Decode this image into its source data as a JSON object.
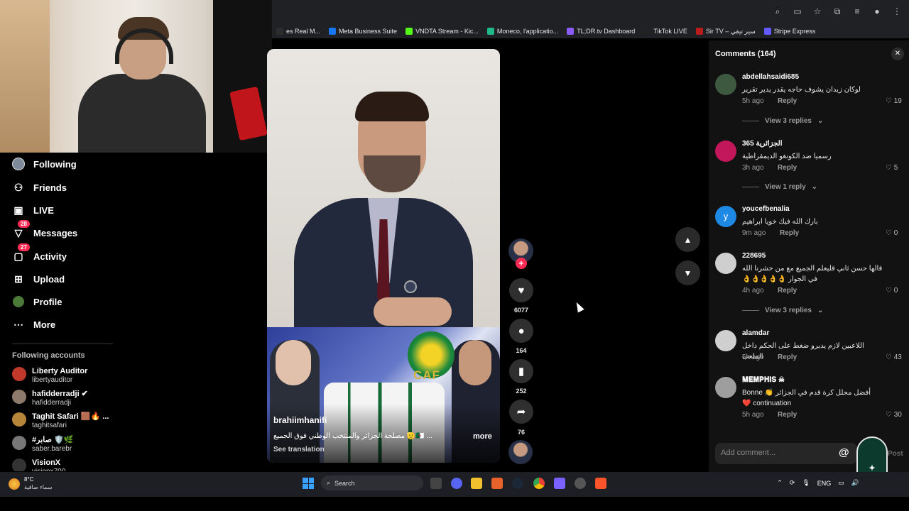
{
  "browser": {
    "bookmarks": [
      {
        "label": "es Real M...",
        "color": "#2d2d2d"
      },
      {
        "label": "Meta Business Suite",
        "color": "#1877f2"
      },
      {
        "label": "VNDTA Stream - Kic...",
        "color": "#53fc18"
      },
      {
        "label": "Moneco, l'applicatio...",
        "color": "#1fb98a"
      },
      {
        "label": "TL;DR.tv Dashboard",
        "color": "#8b5cf6"
      },
      {
        "label": "TikTok LIVE",
        "color": "#222222"
      },
      {
        "label": "Sir TV – سير تيفي",
        "color": "#b91c1c"
      },
      {
        "label": "Stripe Express",
        "color": "#635bff"
      }
    ]
  },
  "nav": {
    "items": [
      {
        "label": "Following",
        "icon": "avatar-icon"
      },
      {
        "label": "Friends",
        "icon": "friends-icon"
      },
      {
        "label": "LIVE",
        "icon": "live-icon"
      },
      {
        "label": "Messages",
        "icon": "messages-icon",
        "badge": "28"
      },
      {
        "label": "Activity",
        "icon": "activity-icon",
        "badge": "27"
      },
      {
        "label": "Upload",
        "icon": "upload-icon"
      },
      {
        "label": "Profile",
        "icon": "profile-icon"
      },
      {
        "label": "More",
        "icon": "more-icon"
      }
    ],
    "following_header": "Following accounts",
    "following": [
      {
        "name": "Liberty Auditor",
        "user": "libertyauditor",
        "color": "#c0392b"
      },
      {
        "name": "hafidderradji ✔",
        "user": "hafidderradji",
        "color": "#8e7a6a"
      },
      {
        "name": "Taghit Safari 🟫🔥 ...",
        "user": "taghitsafari",
        "color": "#b5863a"
      },
      {
        "name": "#صابر 🛡️🌿",
        "user": "saber.barebr",
        "color": "#777777"
      },
      {
        "name": "VisionX",
        "user": "visionx700",
        "color": "#333333"
      }
    ]
  },
  "video": {
    "author": "brahiimhanifi",
    "caption": "مصلحة الجزائر والمنتخب الوطني فوق الجميع 🫡🇩🇿 ...",
    "more_label": "more",
    "translate_label": "See translation",
    "caf_text": "CAF"
  },
  "actions": {
    "likes": "6077",
    "comments": "164",
    "saves": "252",
    "shares": "76"
  },
  "comments": {
    "title": "Comments (164)",
    "reply_label": "Reply",
    "add_placeholder": "Add comment...",
    "at_label": "@",
    "post_label": "Post",
    "items": [
      {
        "user": "abdellahsaidi685",
        "text": "لوكان زيدان يشوف حاجه يقدر يدير تقرير",
        "time": "5h ago",
        "likes": "19",
        "view": "View 3 replies",
        "color": "#3d5a40"
      },
      {
        "user": "الجزائرية 365",
        "text": "رسميا ضد الكونغو الديمقراطية",
        "time": "3h ago",
        "likes": "5",
        "view": "View 1 reply",
        "color": "#c2185b"
      },
      {
        "user": "youcefbenalia",
        "text": "بارك الله فيك خويا ابراهيم",
        "time": "9m ago",
        "likes": "0",
        "view": "",
        "color": "#1e88e5",
        "initial": "y"
      },
      {
        "user": "228695",
        "text": "قالها حسن ثاني قليعلم الجميع مع من حشرنا الله في الجوار 👌👌👌👌👌",
        "time": "4h ago",
        "likes": "0",
        "view": "View 3 replies",
        "color": "#cfcfcf"
      },
      {
        "user": "alamdar",
        "text": "اللاعبين لازم يديرو ضغط على الحكم داخل الملعب",
        "time": "5h ago",
        "likes": "43",
        "view": "",
        "color": "#cfcfcf"
      },
      {
        "user": "𝐌𝐄𝐌𝐏𝐇𝐈𝐒 ☠",
        "text": "أفضل محلل كرة قدم في الجزائر 👏 Bonne continuation ❤️",
        "time": "5h ago",
        "likes": "30",
        "view": "",
        "color": "#9e9e9e"
      }
    ]
  },
  "taskbar": {
    "temp": "8°C",
    "weather": "سماء صافية",
    "search_label": "Search",
    "lang": "ENG"
  }
}
